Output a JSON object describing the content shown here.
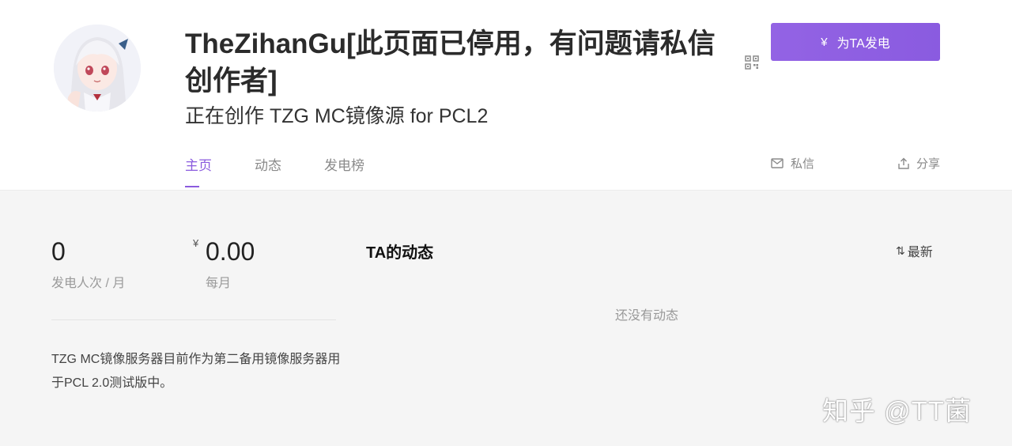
{
  "profile": {
    "name": "TheZihanGu[此页面已停用，有问题请私信创作者]",
    "subtitle": "正在创作 TZG MC镜像源 for PCL2",
    "avatar_icon": "anime-girl-avatar",
    "qr_icon": "qr-code-icon"
  },
  "sponsor_button": {
    "currency": "¥",
    "label": "为TA发电",
    "color": "#8b5bde"
  },
  "tabs": [
    {
      "label": "主页",
      "active": true
    },
    {
      "label": "动态",
      "active": false
    },
    {
      "label": "发电榜",
      "active": false
    }
  ],
  "actions": {
    "message": {
      "label": "私信",
      "icon": "mail-icon"
    },
    "share": {
      "label": "分享",
      "icon": "share-icon"
    }
  },
  "stats": {
    "supporters": {
      "value": "0",
      "label": "发电人次 / 月"
    },
    "amount": {
      "currency": "¥",
      "value": "0.00",
      "label": "每月"
    }
  },
  "description": "TZG MC镜像服务器目前作为第二备用镜像服务器用于PCL 2.0测试版中。",
  "feed": {
    "title": "TA的动态",
    "sort_label": "最新",
    "sort_icon": "sort-icon",
    "empty_text": "还没有动态"
  },
  "watermark": "知乎 @TT菌"
}
